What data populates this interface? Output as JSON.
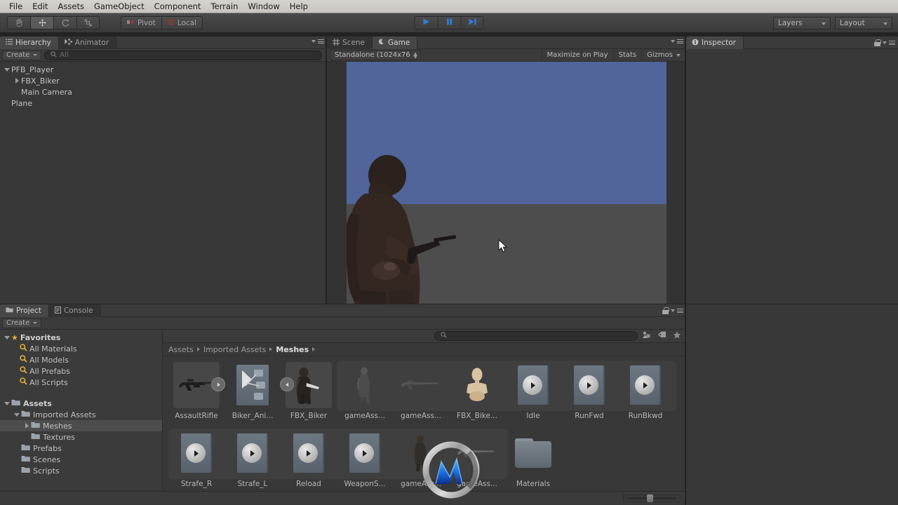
{
  "menu": {
    "items": [
      "File",
      "Edit",
      "Assets",
      "GameObject",
      "Component",
      "Terrain",
      "Window",
      "Help"
    ]
  },
  "toolbar": {
    "tools": [
      {
        "name": "hand-tool",
        "icon": "hand-icon",
        "active": false
      },
      {
        "name": "move-tool",
        "icon": "move-icon",
        "active": true
      },
      {
        "name": "rotate-tool",
        "icon": "rotate-icon",
        "active": false
      },
      {
        "name": "scale-tool",
        "icon": "scale-icon",
        "active": false
      }
    ],
    "pivot_label": "Pivot",
    "local_label": "Local",
    "play_label": "Play",
    "pause_label": "Pause",
    "step_label": "Step",
    "layers_label": "Layers",
    "layout_label": "Layout",
    "play_active_color": "#2f7fd8"
  },
  "hierarchy": {
    "tabs": [
      {
        "label": "Hierarchy",
        "icon": "hierarchy-icon",
        "active": true
      },
      {
        "label": "Animator",
        "icon": "animator-icon",
        "active": false
      }
    ],
    "create_label": "Create",
    "search_placeholder": "All",
    "items": [
      {
        "label": "PFB_Player",
        "depth": 0,
        "twisty": "down"
      },
      {
        "label": "FBX_Biker",
        "depth": 1,
        "twisty": "right"
      },
      {
        "label": "Main Camera",
        "depth": 1,
        "twisty": "none"
      },
      {
        "label": "Plane",
        "depth": 0,
        "twisty": "none"
      }
    ]
  },
  "gameview": {
    "tabs": [
      {
        "label": "Scene",
        "icon": "scene-icon",
        "active": false
      },
      {
        "label": "Game",
        "icon": "game-icon",
        "active": true
      }
    ],
    "resolution_label": "Standalone (1024x76",
    "maximize_label": "Maximize on Play",
    "stats_label": "Stats",
    "gizmos_label": "Gizmos",
    "sky_color": "#51659b",
    "ground_color": "#4d4d4d"
  },
  "inspector": {
    "tabs": [
      {
        "label": "Inspector",
        "icon": "inspector-icon",
        "active": true
      }
    ],
    "lock_icon": "lock-icon",
    "menu_icon": "hamburger-icon"
  },
  "project": {
    "tabs": [
      {
        "label": "Project",
        "icon": "project-icon",
        "active": true
      },
      {
        "label": "Console",
        "icon": "console-icon",
        "active": false
      }
    ],
    "create_label": "Create",
    "search_placeholder": "",
    "filter_icons": [
      "type-filter-icon",
      "label-filter-icon",
      "favorite-filter-icon"
    ],
    "breadcrumb": [
      "Assets",
      "Imported Assets",
      "Meshes"
    ],
    "tree": [
      {
        "label": "Favorites",
        "depth": 0,
        "twisty": "down",
        "icon": "star-icon",
        "bold": true,
        "selected": false
      },
      {
        "label": "All Materials",
        "depth": 1,
        "twisty": "none",
        "icon": "search-icon",
        "bold": false,
        "selected": false
      },
      {
        "label": "All Models",
        "depth": 1,
        "twisty": "none",
        "icon": "search-icon",
        "bold": false,
        "selected": false
      },
      {
        "label": "All Prefabs",
        "depth": 1,
        "twisty": "none",
        "icon": "search-icon",
        "bold": false,
        "selected": false
      },
      {
        "label": "All Scripts",
        "depth": 1,
        "twisty": "none",
        "icon": "search-icon",
        "bold": false,
        "selected": false
      },
      {
        "label": "",
        "depth": 0,
        "twisty": "none",
        "icon": "none",
        "bold": false,
        "selected": false
      },
      {
        "label": "Assets",
        "depth": 0,
        "twisty": "down",
        "icon": "folder-icon",
        "bold": true,
        "selected": false
      },
      {
        "label": "Imported Assets",
        "depth": 1,
        "twisty": "down",
        "icon": "folder-icon",
        "bold": false,
        "selected": false
      },
      {
        "label": "Meshes",
        "depth": 2,
        "twisty": "right",
        "icon": "folder-icon",
        "bold": false,
        "selected": true
      },
      {
        "label": "Textures",
        "depth": 2,
        "twisty": "none",
        "icon": "folder-icon",
        "bold": false,
        "selected": false
      },
      {
        "label": "Prefabs",
        "depth": 1,
        "twisty": "none",
        "icon": "folder-icon",
        "bold": false,
        "selected": false
      },
      {
        "label": "Scenes",
        "depth": 1,
        "twisty": "none",
        "icon": "folder-icon",
        "bold": false,
        "selected": false
      },
      {
        "label": "Scripts",
        "depth": 1,
        "twisty": "none",
        "icon": "folder-icon",
        "bold": false,
        "selected": false
      }
    ],
    "assets_row1": [
      {
        "label": "AssaultRifle",
        "kind": "model-rifle",
        "badge": "right"
      },
      {
        "label": "Biker_Ani...",
        "kind": "animator-controller",
        "badge": "none"
      },
      {
        "label": "FBX_Biker",
        "kind": "model-character",
        "badge": "left"
      },
      {
        "label": "gameAss...",
        "kind": "model-character-small",
        "badge": "none"
      },
      {
        "label": "gameAss...",
        "kind": "model-rifle-small",
        "badge": "none"
      },
      {
        "label": "FBX_Bike...",
        "kind": "avatar",
        "badge": "none"
      },
      {
        "label": "Idle",
        "kind": "animation-clip",
        "badge": "none"
      },
      {
        "label": "RunFwd",
        "kind": "animation-clip",
        "badge": "none"
      },
      {
        "label": "RunBkwd",
        "kind": "animation-clip",
        "badge": "none"
      }
    ],
    "assets_row2": [
      {
        "label": "Strafe_R",
        "kind": "animation-clip",
        "badge": "none"
      },
      {
        "label": "Strafe_L",
        "kind": "animation-clip",
        "badge": "none"
      },
      {
        "label": "Reload",
        "kind": "animation-clip",
        "badge": "none"
      },
      {
        "label": "WeaponS...",
        "kind": "animation-clip",
        "badge": "none"
      },
      {
        "label": "gameAss...",
        "kind": "model-character-small",
        "badge": "none"
      },
      {
        "label": "gameAss...",
        "kind": "model-rifle-small",
        "badge": "none"
      },
      {
        "label": "Materials",
        "kind": "folder",
        "badge": "none"
      }
    ]
  }
}
